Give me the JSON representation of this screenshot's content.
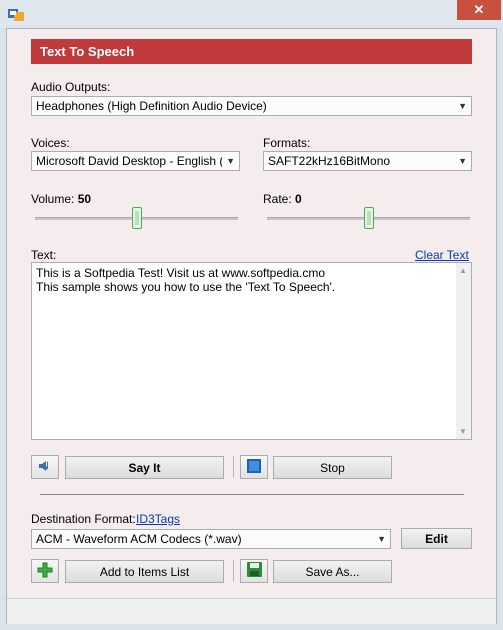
{
  "window": {
    "close_label": "✕"
  },
  "header": {
    "title": "Text To Speech"
  },
  "audio_outputs": {
    "label": "Audio Outputs:",
    "value": "Headphones (High Definition Audio Device)"
  },
  "voices": {
    "label": "Voices:",
    "value": "Microsoft David Desktop - English (Unit"
  },
  "formats": {
    "label": "Formats:",
    "value": "SAFT22kHz16BitMono"
  },
  "volume": {
    "label": "Volume:",
    "value": "50",
    "level": 50
  },
  "rate": {
    "label": "Rate:",
    "value": "0",
    "level": 0
  },
  "text_section": {
    "label": "Text:",
    "clear_link": "Clear Text",
    "content": "This is a Softpedia Test! Visit us at www.softpedia.cmo\nThis sample shows you how to use the 'Text To Speech'."
  },
  "buttons": {
    "say_it": "Say It",
    "stop": "Stop",
    "add_to_items": "Add to Items List",
    "save_as": "Save As...",
    "edit": "Edit"
  },
  "destination": {
    "label": "Destination Format:",
    "id3_link": "ID3Tags",
    "value": "ACM - Waveform ACM Codecs (*.wav)"
  },
  "colors": {
    "header": "#c0393b",
    "accent_green": "#4caa4c",
    "link": "#0a3aa8"
  },
  "icons": [
    "app-icon",
    "music-note-icon",
    "stop-square-icon",
    "add-plus-icon",
    "save-disk-icon",
    "dropdown-arrow-icon"
  ]
}
